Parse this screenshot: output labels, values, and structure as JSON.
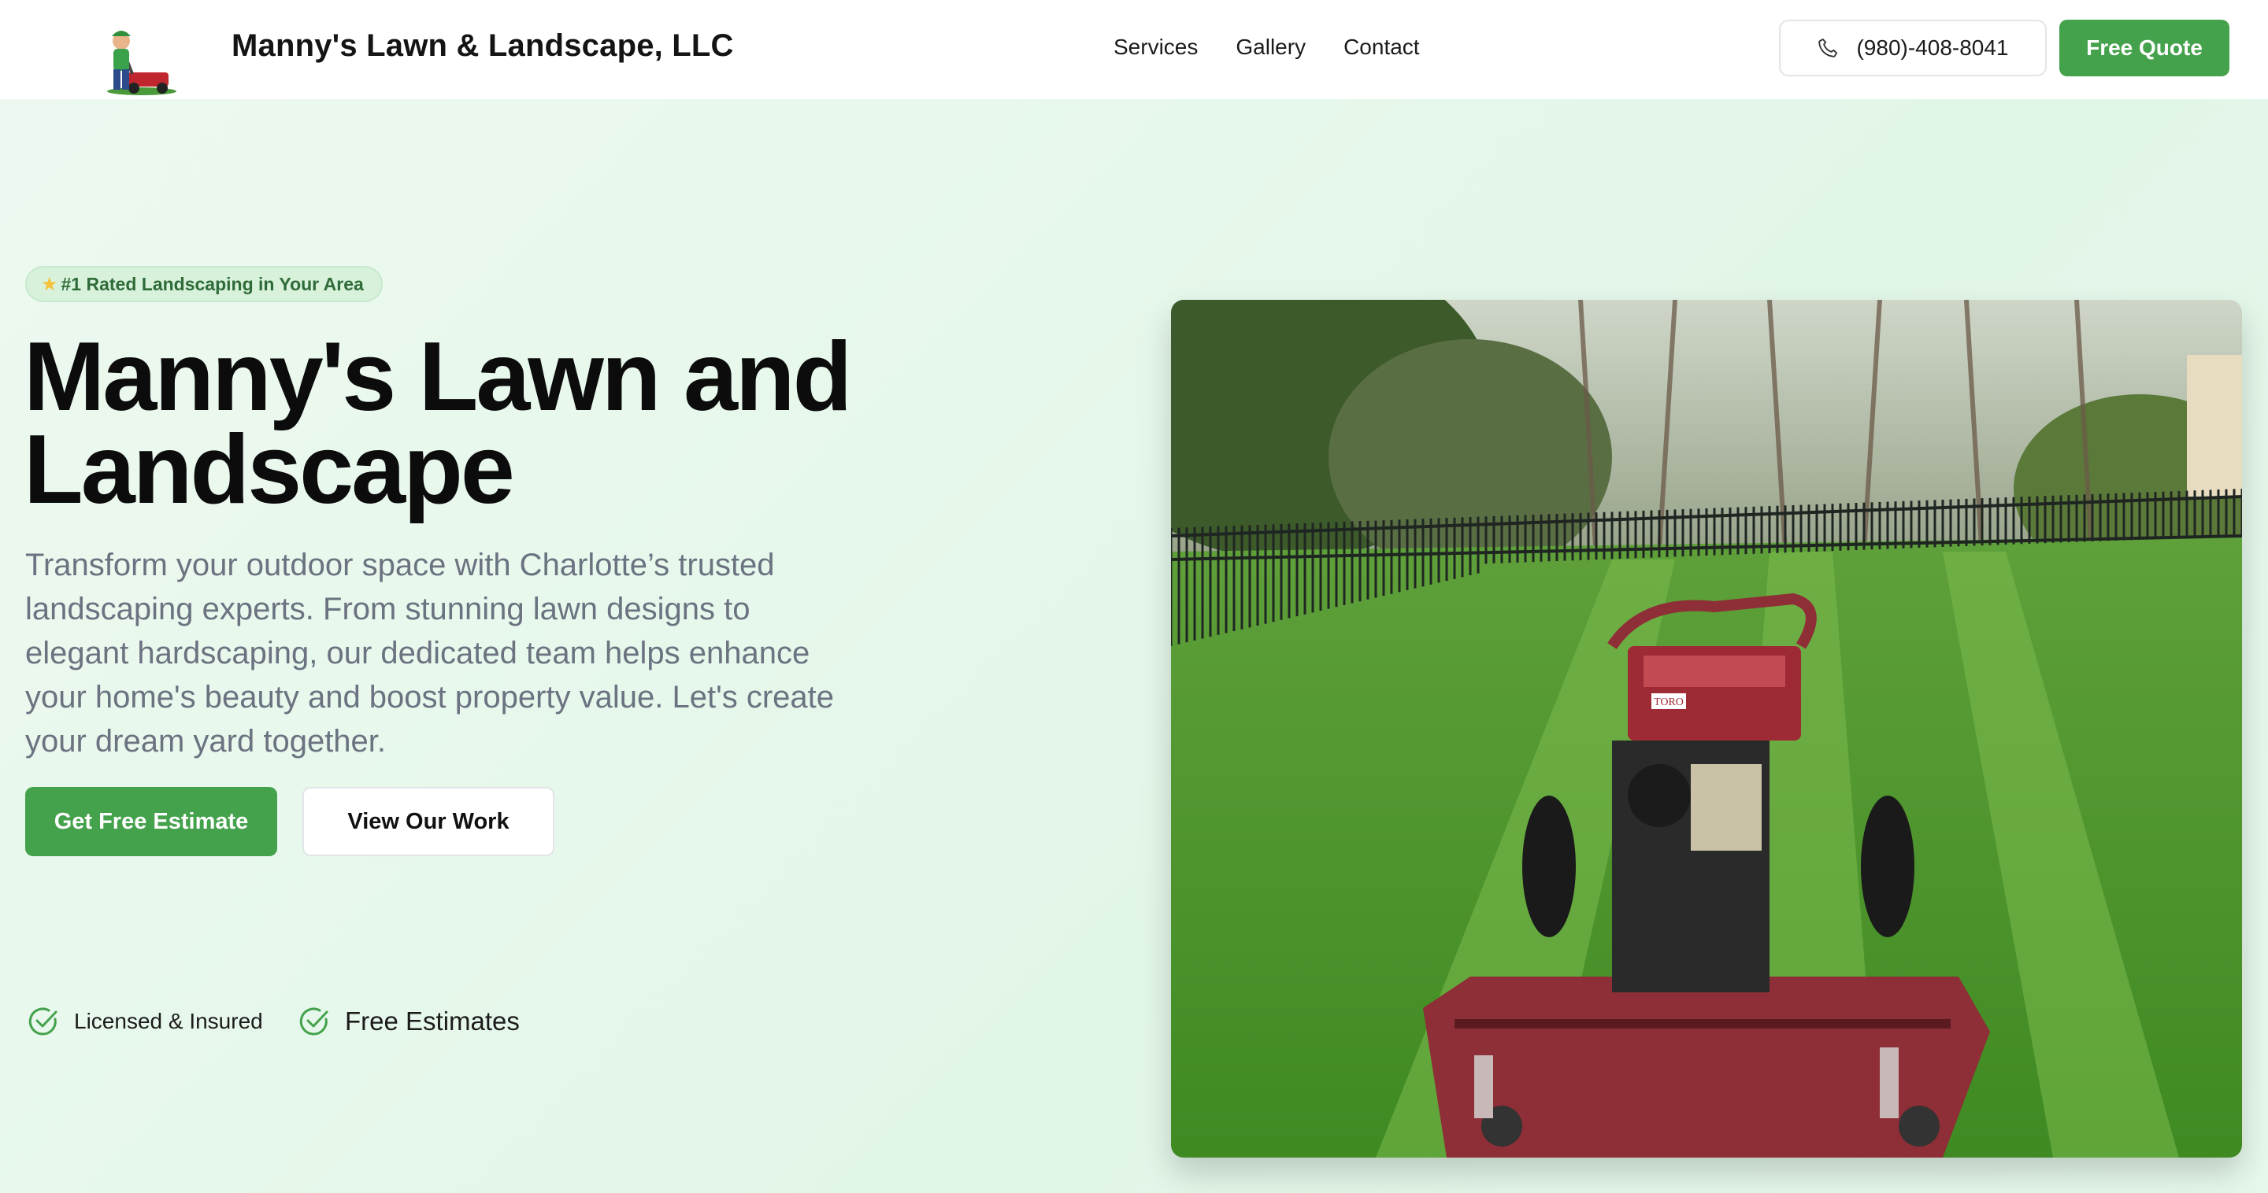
{
  "header": {
    "brand": "Manny's Lawn & Landscape, LLC",
    "nav": [
      "Services",
      "Gallery",
      "Contact"
    ],
    "phone": "(980)-408-8041",
    "quote_label": "Free Quote"
  },
  "hero": {
    "badge": "#1 Rated Landscaping in Your Area",
    "title_line1": "Manny's Lawn and",
    "title_line2": "Landscape",
    "description": "Transform your outdoor space with Charlotte’s trusted landscaping experts. From stunning lawn designs to elegant hardscaping, our dedicated team helps enhance your home's beauty and boost property value. Let's create your dream yard together.",
    "primary_cta": "Get Free Estimate",
    "secondary_cta": "View Our Work",
    "trust": [
      "Licensed & Insured",
      "Free Estimates"
    ]
  },
  "photo": {
    "mower_brand": "TORO"
  },
  "colors": {
    "accent": "#45a24c",
    "background": "#e8f7ec",
    "muted_text": "#6b7280"
  }
}
